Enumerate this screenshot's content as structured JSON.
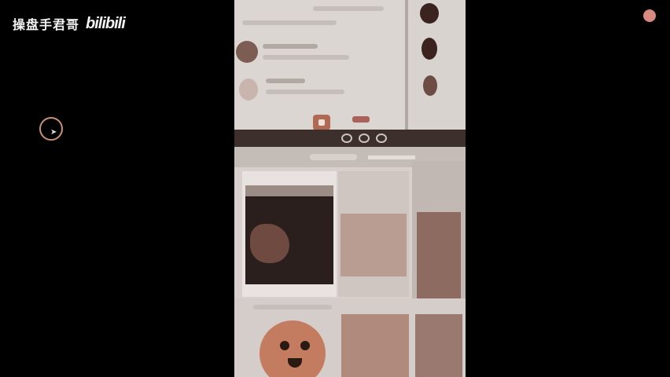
{
  "watermark": {
    "channel": "操盘手君哥",
    "logo": "bilibili"
  },
  "colors": {
    "background": "#000000",
    "accent": "#b06a54",
    "record_dot": "#d98a80",
    "cursor_ring": "#c89077"
  },
  "icons": {
    "cursor": "mouse-pointer-icon",
    "record": "record-dot-icon"
  }
}
